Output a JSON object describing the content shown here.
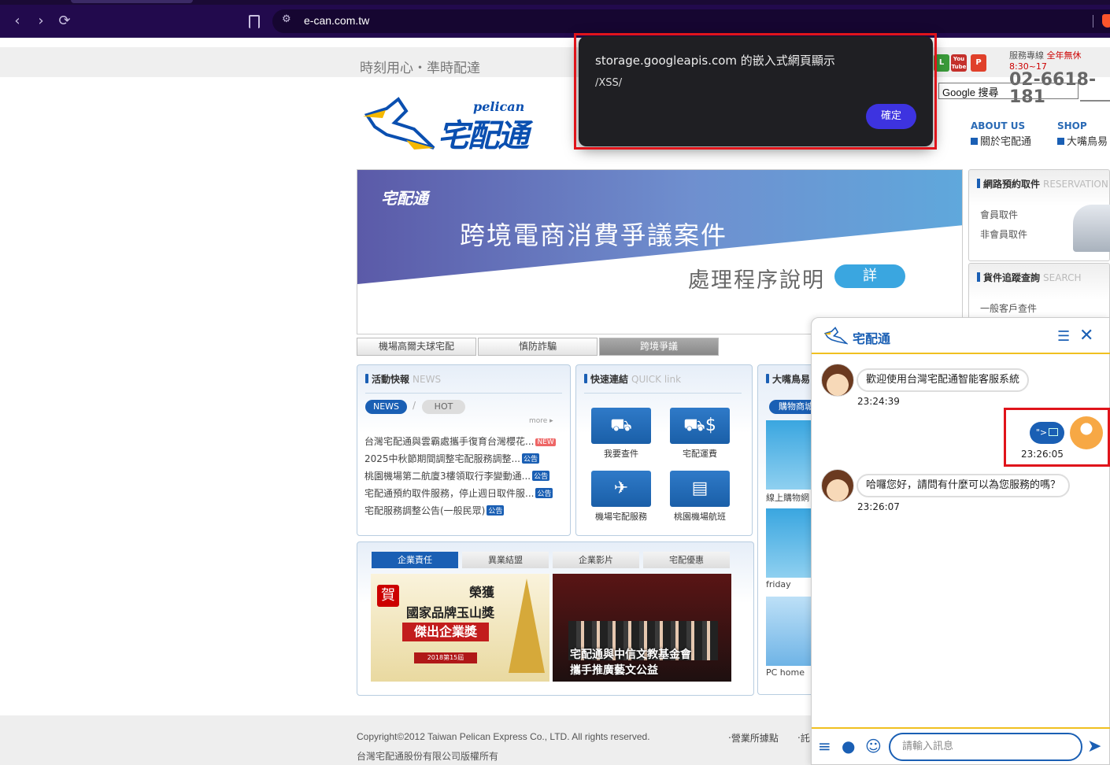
{
  "browser": {
    "url": "e-can.com.tw",
    "back_icon": "‹",
    "forward_icon": "›",
    "reload_icon": "⟳"
  },
  "site": {
    "tagline": "時刻用心・準時配達",
    "logo_en": "pelican",
    "logo_zh": "宅配通",
    "hotline_label": "服務專線",
    "hotline_hours": "全年無休8:30~17",
    "hotline_number": "02-6618-181",
    "youtube_label": "You Tube",
    "search_placeholder": "Google 搜尋",
    "nav": [
      {
        "en": "ABOUT US",
        "zh": "關於宅配通"
      },
      {
        "en": "SHOP",
        "zh": "大嘴鳥易"
      }
    ]
  },
  "banner": {
    "logo": "宅配通",
    "title": "跨境電商消費爭議案件",
    "subtitle": "處理程序說明",
    "button": "詳情",
    "tabs": [
      "機場高爾夫球宅配",
      "慎防詐騙",
      "跨境爭議"
    ]
  },
  "news": {
    "title": "活動快報",
    "title_en": "NEWS",
    "tab_news": "NEWS",
    "tab_hot": "HOT",
    "more": "more ▸",
    "items": [
      {
        "text": "台灣宅配通與雲霸處攜手復育台灣櫻花...",
        "badge": "NEW"
      },
      {
        "text": "2025中秋節期間調整宅配服務調整...",
        "badge": "公告"
      },
      {
        "text": "桃園機場第二航廈3樓領取行李變動通...",
        "badge": "公告"
      },
      {
        "text": "宅配通預約取件服務，停止週日取件服...",
        "badge": "公告"
      },
      {
        "text": "宅配服務調整公告(一般民眾)",
        "badge": "公告"
      }
    ]
  },
  "quick": {
    "title": "快速連結",
    "title_en": "QUICK link",
    "tiles": [
      {
        "label": "我要查件",
        "icon": "truck-chat-icon"
      },
      {
        "label": "宅配運費",
        "icon": "truck-dollar-icon"
      },
      {
        "label": "機場宅配服務",
        "icon": "airport-luggage-icon"
      },
      {
        "label": "桃園機場航班",
        "icon": "flight-board-icon"
      }
    ]
  },
  "shop": {
    "title": "大嘴鳥易",
    "tab": "購物商城",
    "items": [
      "線上購物網",
      "friday",
      "PC home"
    ]
  },
  "corp": {
    "tabs": [
      "企業責任",
      "異業結盟",
      "企業影片",
      "宅配優惠"
    ],
    "img1_title": "榮獲",
    "img1_line2": "國家品牌玉山獎",
    "img1_line3": "傑出企業獎",
    "img1_congrats": "賀",
    "img1_year": "2018第15屆",
    "img2_caption_1": "宅配通與中信文教基金會",
    "img2_caption_2": "攜手推廣藝文公益"
  },
  "right": {
    "reserve_title": "網路預約取件",
    "reserve_en": "RESERVATION",
    "reserve_links": [
      "會員取件",
      "非會員取件"
    ],
    "track_title": "貨件追蹤查詢",
    "track_en": "SEARCH",
    "track_links": [
      "一般客戶查件"
    ]
  },
  "footer": {
    "copyright": "Copyright©2012 Taiwan Pelican Express Co., LTD. All rights reserved.",
    "company": "台灣宅配通股份有限公司版權所有",
    "link1": "‧營業所據點",
    "link2": "‧託"
  },
  "alert": {
    "title": "storage.googleapis.com 的嵌入式網頁顯示",
    "message": "/XSS/",
    "ok": "確定"
  },
  "chat": {
    "name": "宅配通",
    "messages": [
      {
        "from": "bot",
        "text": "歡迎使用台灣宅配通智能客服系統",
        "time": "23:24:39"
      },
      {
        "from": "user",
        "text": "\">",
        "time": "23:26:05"
      },
      {
        "from": "bot",
        "text": "哈囉您好，請問有什麼可以為您服務的嗎？",
        "time": "23:26:07"
      }
    ],
    "input_placeholder": "請輸入訊息"
  },
  "colors": {
    "brand_blue": "#1a5fb4",
    "alert_button": "#3d33e0",
    "highlight_red": "#e0141b",
    "chat_accent": "#f0c020"
  }
}
